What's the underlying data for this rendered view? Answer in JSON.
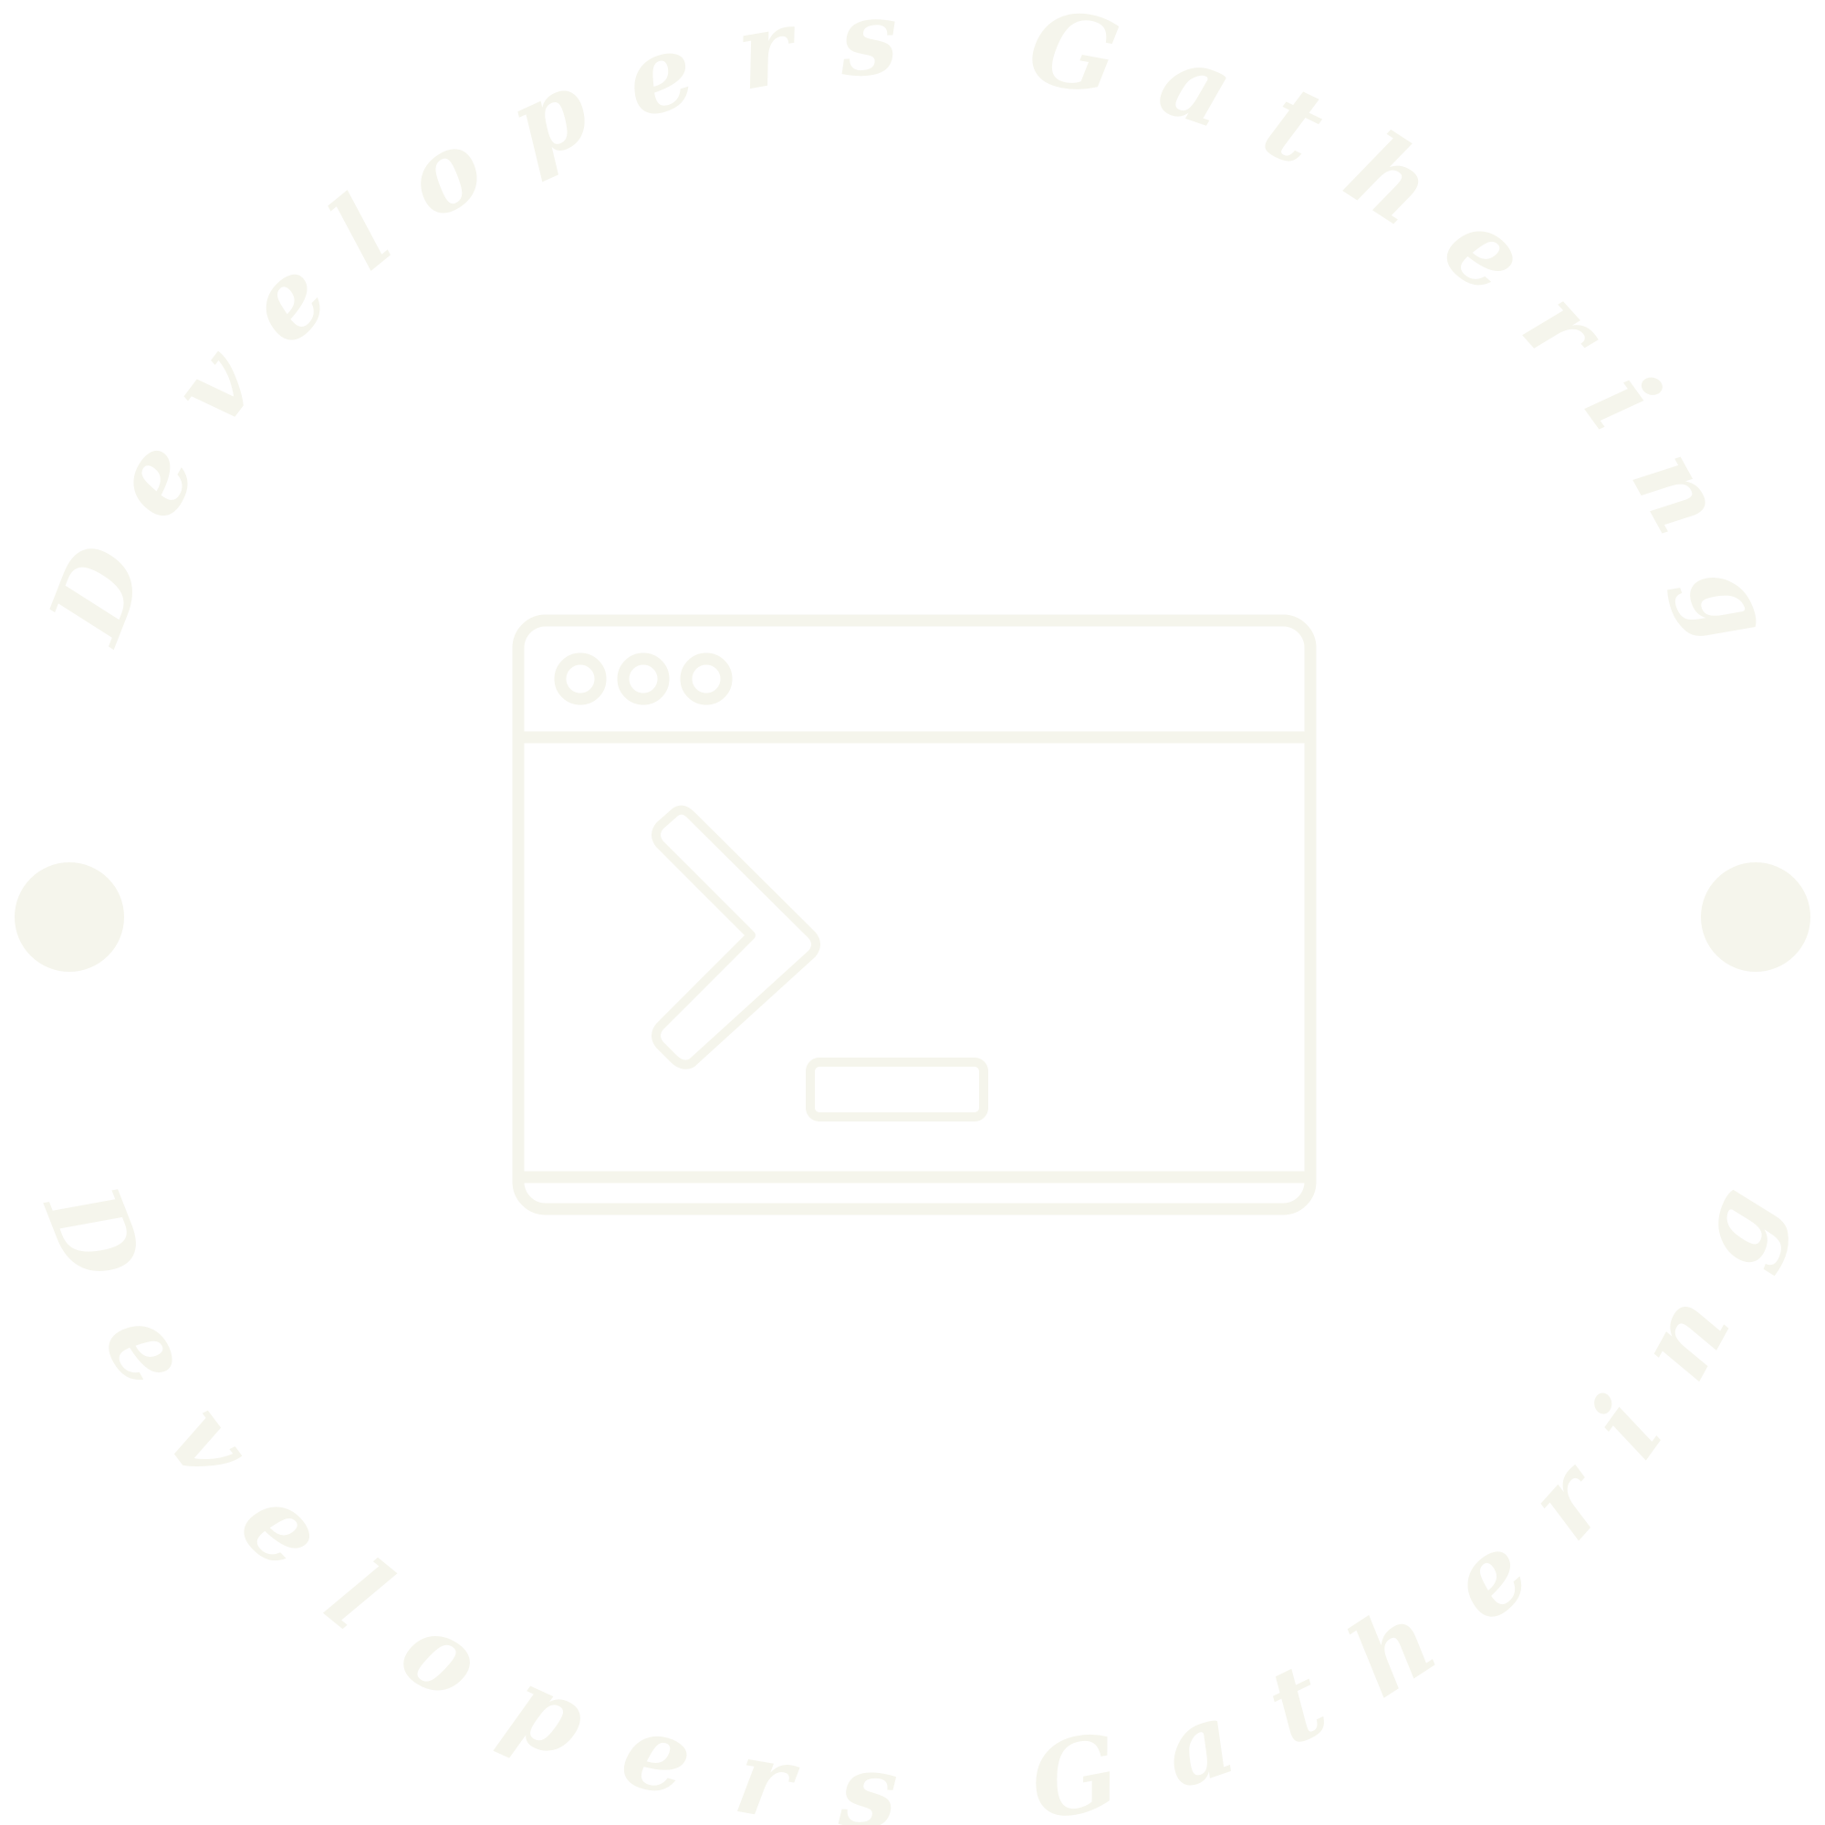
{
  "logo": {
    "top_text": "Developers Gathering",
    "bottom_text": "Developers Gathering",
    "color": "#f5f5ec",
    "icon": "terminal-window-icon"
  }
}
